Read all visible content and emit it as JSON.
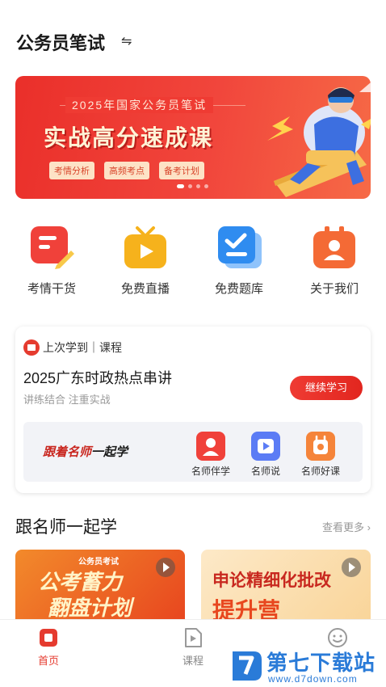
{
  "header": {
    "title": "公务员笔试",
    "switch_symbol": "⇋"
  },
  "banner": {
    "subtitle": "2025年国家公务员笔试",
    "main_title": "实战高分速成课",
    "tags": [
      "考情分析",
      "高频考点",
      "备考计划"
    ],
    "active_dot": 0,
    "dot_count": 4
  },
  "quick_entries": [
    {
      "label": "考情干货",
      "icon": "notes-pencil-icon",
      "color": "#f0413a"
    },
    {
      "label": "免费直播",
      "icon": "tv-play-icon",
      "color": "#f6b21c"
    },
    {
      "label": "免费题库",
      "icon": "checklist-icon",
      "color": "#2f8cf0"
    },
    {
      "label": "关于我们",
      "icon": "person-badge-icon",
      "color": "#f46a35"
    }
  ],
  "last_study": {
    "label": "上次学到｜课程",
    "course_title": "2025广东时政热点串讲",
    "course_subtitle": "讲练结合 注重实战",
    "continue_label": "继续学习"
  },
  "teacher_box": {
    "slogan_red": "跟着名师",
    "slogan_black": "一起学",
    "items": [
      {
        "label": "名师伴学",
        "icon": "teacher-avatar-icon",
        "color": "#f0413a"
      },
      {
        "label": "名师说",
        "icon": "video-play-icon",
        "color": "#5b7cf5"
      },
      {
        "label": "名师好课",
        "icon": "course-badge-icon",
        "color": "#f5843a"
      }
    ]
  },
  "section": {
    "title": "跟名师一起学",
    "more_label": "查看更多 ›"
  },
  "thumbs": [
    {
      "top_label": "公务员考试",
      "line1": "公考蓄力",
      "line2": "翻盘计划"
    },
    {
      "line1": "申论精细化批改",
      "line2": "提升营"
    }
  ],
  "tabbar": {
    "tabs": [
      {
        "label": "首页",
        "icon": "home-icon",
        "active": true
      },
      {
        "label": "课程",
        "icon": "course-play-icon",
        "active": false
      },
      {
        "label": "",
        "icon": "smile-face-icon",
        "active": false
      }
    ]
  },
  "watermark": {
    "big": "第七下载站",
    "small": "www.d7down.com"
  },
  "colors": {
    "brand_red": "#e53b2f",
    "text": "#1a1a1a",
    "muted": "#999999"
  }
}
